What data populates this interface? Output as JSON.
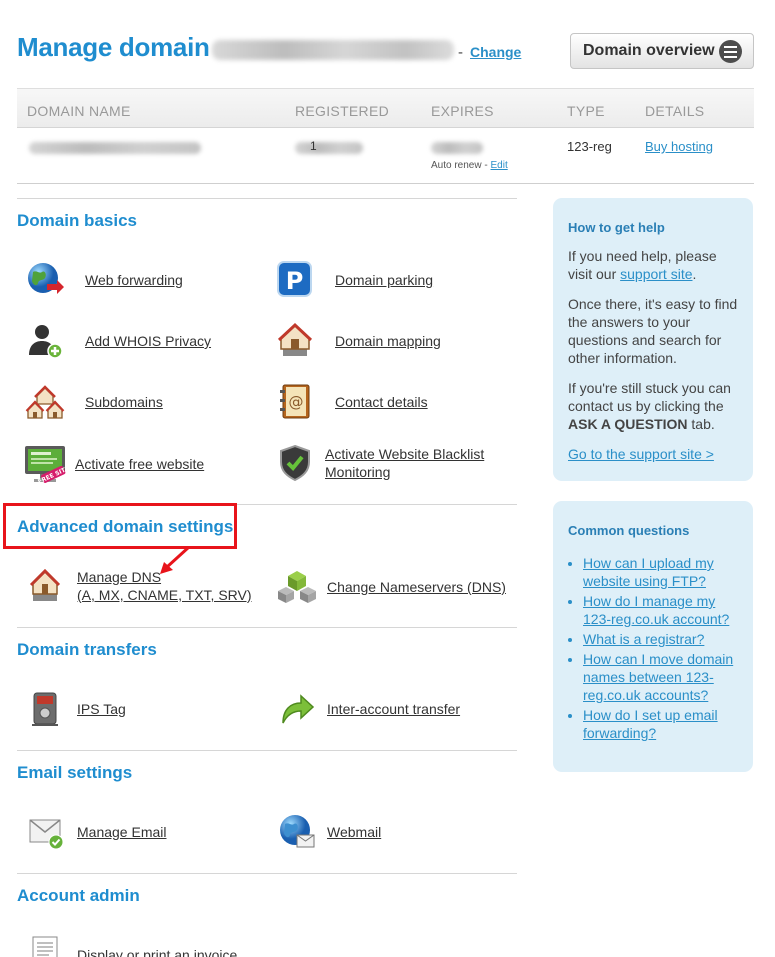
{
  "header": {
    "title": "Manage domain",
    "separator": "-",
    "change_link": "Change",
    "overview_button": "Domain overview"
  },
  "domain_table": {
    "columns": [
      "DOMAIN NAME",
      "REGISTERED",
      "EXPIRES",
      "TYPE",
      "DETAILS"
    ],
    "row": {
      "registered_partial": "1",
      "auto_renew_label": "Auto renew - ",
      "auto_renew_edit": "Edit",
      "type": "123-reg",
      "details_link": "Buy hosting"
    }
  },
  "sections": {
    "domain_basics": {
      "title": "Domain basics",
      "items": [
        "Web forwarding",
        "Domain parking",
        "Add WHOIS Privacy",
        "Domain mapping",
        "Subdomains",
        "Contact details",
        "Activate free website"
      ],
      "blacklist_line1": "Activate Website Blacklist",
      "blacklist_line2": "Monitoring"
    },
    "advanced": {
      "title": "Advanced domain settings",
      "manage_dns_line1": "Manage DNS",
      "manage_dns_line2": "(A, MX, CNAME, TXT, SRV)",
      "change_nameservers": "Change Nameservers (DNS)"
    },
    "transfers": {
      "title": "Domain transfers",
      "items": [
        "IPS Tag",
        "Inter-account transfer"
      ]
    },
    "email": {
      "title": "Email settings",
      "items": [
        "Manage Email",
        "Webmail"
      ]
    },
    "account": {
      "title": "Account admin",
      "items": [
        "Display or print an invoice"
      ]
    }
  },
  "help_panel": {
    "title": "How to get help",
    "p1_before": "If you need help, please visit our ",
    "p1_link": "support site",
    "p1_after": ".",
    "p2": "Once there, it's easy to find the answers to your questions and search for other information.",
    "p3_before": "If you're still stuck you can contact us by clicking the ",
    "p3_bold": "ASK A QUESTION",
    "p3_after": " tab.",
    "support_link": "Go to the support site >"
  },
  "questions_panel": {
    "title": "Common questions",
    "items": [
      "How can I upload my website using FTP?",
      "How do I manage my 123-reg.co.uk account?",
      "What is a registrar?",
      "How can I move domain names between 123-reg.co.uk accounts?",
      "How do I set up email forwarding?"
    ]
  },
  "icons": {
    "web_forwarding": "globe-arrow-icon",
    "domain_parking": "parking-sign-icon",
    "whois": "user-add-icon",
    "mapping": "house-map-icon",
    "subdomains": "houses-icon",
    "contact": "address-book-icon",
    "free_website": "free-site-monitor-icon",
    "blacklist": "shield-check-icon"
  },
  "colors": {
    "accent": "#1f8dcf",
    "link": "#2a8fc8",
    "panel_bg": "#deeff8",
    "highlight": "#e8141b"
  }
}
